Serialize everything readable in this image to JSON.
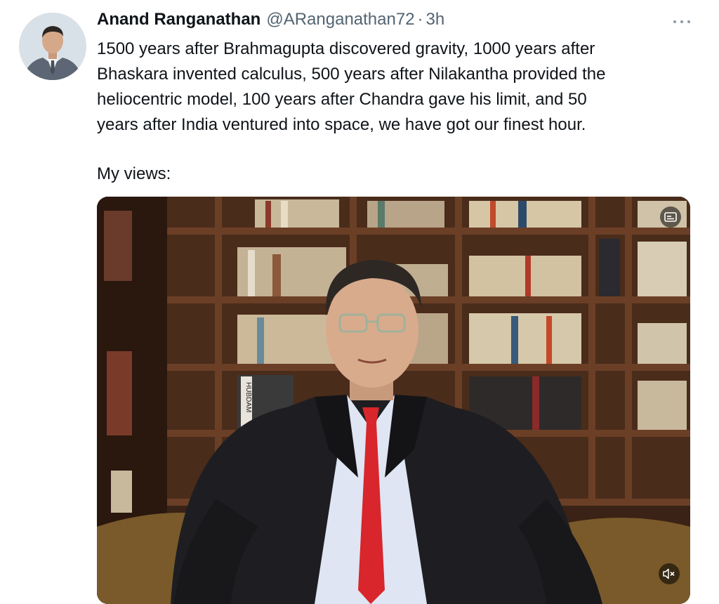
{
  "tweet": {
    "author_name": "Anand Ranganathan",
    "author_handle": "@ARanganathan72",
    "separator": "·",
    "timestamp": "3h",
    "body_lines": [
      "1500 years after Brahmagupta discovered gravity, 1000 years after",
      "Bhaskara invented calculus, 500 years after Nilakantha provided the",
      "heliocentric model, 100 years after Chandra gave his limit, and 50",
      "years after India ventured into space, we have got our finest hour."
    ],
    "views_label": "My views:",
    "book_spine_text": "HUBDAM"
  },
  "icons": {
    "more": "more-horizontal-icon",
    "captions": "captions-icon",
    "mute": "muted-speaker-icon"
  },
  "colors": {
    "text": "#0f1419",
    "secondary": "#536471",
    "tie": "#d8262c",
    "shelf": "#5a3420"
  }
}
